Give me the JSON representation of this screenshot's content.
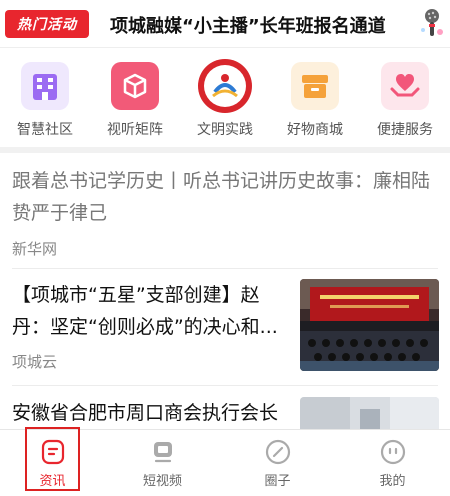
{
  "banner": {
    "badge": "热门活动",
    "title": "项城融媒“小主播”长年班报名通道",
    "mic_icon": "microphone-icon"
  },
  "services": [
    {
      "label": "智慧社区",
      "icon": "building-icon",
      "color": "#9b6bf2"
    },
    {
      "label": "视听矩阵",
      "icon": "cube-icon",
      "color": "#f25a78"
    },
    {
      "label": "文明实践",
      "icon": "civilization-emblem-icon",
      "color": "#d8262c"
    },
    {
      "label": "好物商城",
      "icon": "store-box-icon",
      "color": "#f5a23a"
    },
    {
      "label": "便捷服务",
      "icon": "heart-hands-icon",
      "color": "#f2567a"
    }
  ],
  "news": [
    {
      "title": "跟着总书记学历史丨听总书记讲历史故事：廉相陆贽严于律己",
      "source": "新华网"
    },
    {
      "title": "【项城市“五星”支部创建】赵丹：坚定“创则必成”的决心和...",
      "source": "项城云"
    },
    {
      "title": "安徽省合肥市周口商会执行会长",
      "source": ""
    }
  ],
  "tabs": [
    {
      "label": "资讯",
      "icon": "news-icon",
      "active": true
    },
    {
      "label": "短视频",
      "icon": "video-icon",
      "active": false
    },
    {
      "label": "圈子",
      "icon": "compass-icon",
      "active": false
    },
    {
      "label": "我的",
      "icon": "profile-icon",
      "active": false
    }
  ],
  "colors": {
    "accent": "#e8262e",
    "muted_text": "#888888"
  }
}
